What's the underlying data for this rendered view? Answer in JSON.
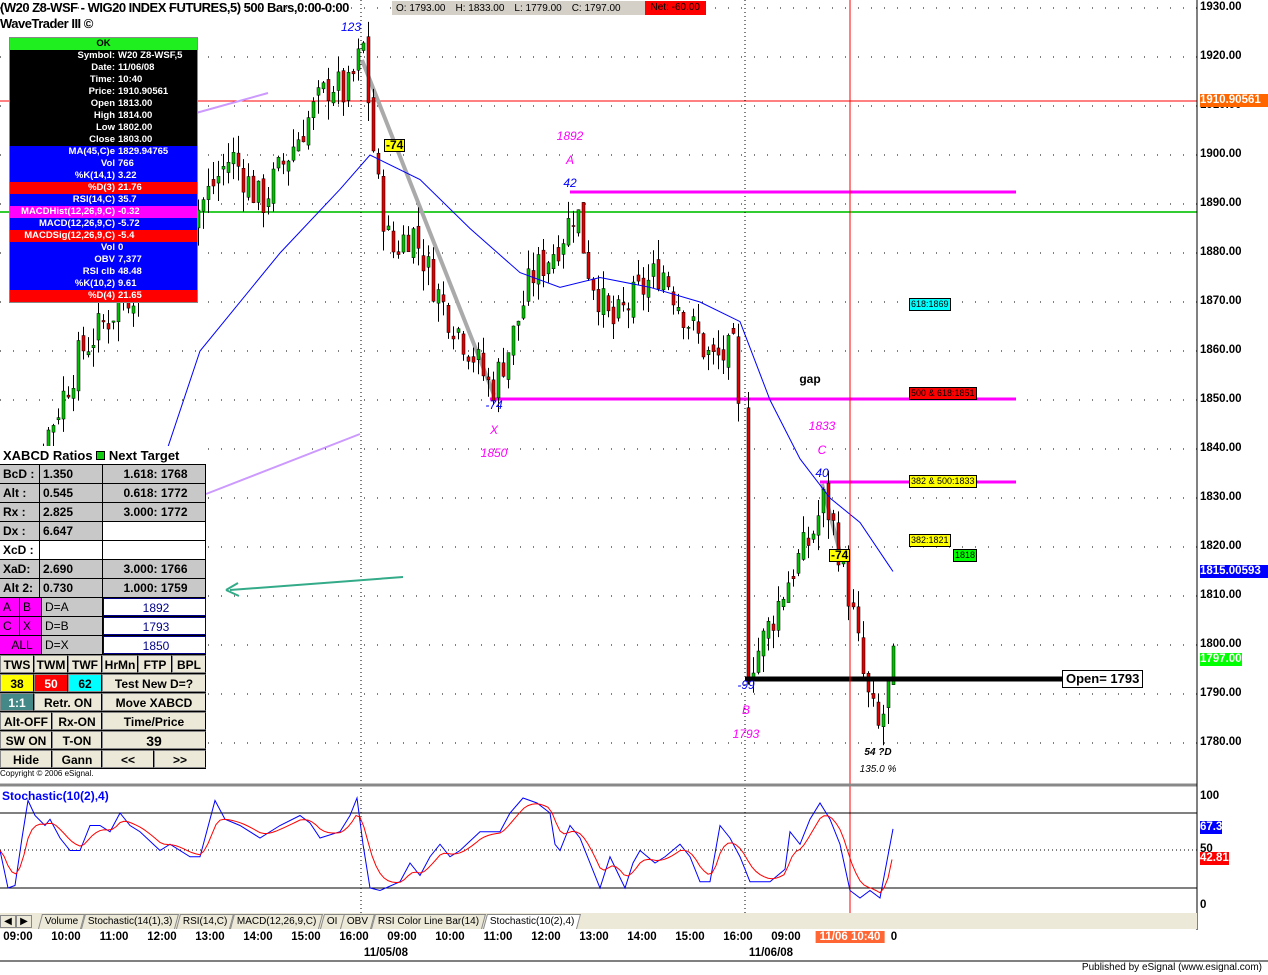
{
  "header": {
    "title": "(W20 Z8-WSF - WIG20 INDEX FUTURES,5) 500 Bars,0:00-0:00",
    "subtitle": "WaveTrader III ©",
    "ohlc": {
      "open": "O: 1793.00",
      "high": "H: 1833.00",
      "low": "L: 1779.00",
      "close": "C: 1797.00",
      "net": "Net: -60.00"
    }
  },
  "info_panel": {
    "status": "OK",
    "rows": [
      {
        "l": "Symbol:",
        "v": "W20 Z8-WSF,5",
        "c": "bk"
      },
      {
        "l": "Date:",
        "v": "11/06/08",
        "c": "bk"
      },
      {
        "l": "Time:",
        "v": "10:40",
        "c": "bk"
      },
      {
        "l": "Price:",
        "v": "1910.90561",
        "c": "bk"
      },
      {
        "l": "Open",
        "v": "1813.00",
        "c": "bk"
      },
      {
        "l": "High",
        "v": "1814.00",
        "c": "bk"
      },
      {
        "l": "Low",
        "v": "1802.00",
        "c": "bk"
      },
      {
        "l": "Close",
        "v": "1803.00",
        "c": "bk"
      },
      {
        "l": "MA(45,C)e",
        "v": "1829.94765",
        "c": "bl"
      },
      {
        "l": "Vol",
        "v": "766",
        "c": "bl"
      },
      {
        "l": "%K(14,1)",
        "v": "3.22",
        "c": "bl"
      },
      {
        "l": "%D(3)",
        "v": "21.76",
        "c": "rd"
      },
      {
        "l": "RSI(14,C)",
        "v": "35.7",
        "c": "bl"
      },
      {
        "l": "MACDHist(12,26,9,C)",
        "v": "-0.32",
        "c": "mg"
      },
      {
        "l": "MACD(12,26,9,C)",
        "v": "-5.72",
        "c": "bl"
      },
      {
        "l": "MACDSig(12,26,9,C)",
        "v": "-5.4",
        "c": "rd"
      },
      {
        "l": "Vol",
        "v": "0",
        "c": "bl"
      },
      {
        "l": "OBV",
        "v": "7,377",
        "c": "bl"
      },
      {
        "l": "RSI clb",
        "v": "48.48",
        "c": "bl"
      },
      {
        "l": "%K(10,2)",
        "v": "9.61",
        "c": "bl"
      },
      {
        "l": "%D(4)",
        "v": "21.65",
        "c": "rd"
      }
    ]
  },
  "xabcd": {
    "header": "XABCD Ratios",
    "next_target": "Next Target",
    "ratios": [
      {
        "n": "BcD :",
        "v": "1.350",
        "t": "1.618: 1768"
      },
      {
        "n": "Alt  :",
        "v": "0.545",
        "t": "0.618: 1772"
      },
      {
        "n": "Rx  :",
        "v": "2.825",
        "t": "3.000: 1772"
      },
      {
        "n": "Dx  :",
        "v": "6.647",
        "t": ""
      },
      {
        "n": "XcD :",
        "v": "",
        "t": ""
      },
      {
        "n": "XaD:",
        "v": "2.690",
        "t": "3.000: 1766"
      },
      {
        "n": "Alt 2:",
        "v": "0.730",
        "t": "1.000: 1759"
      }
    ],
    "points": [
      {
        "a": "A",
        "b": "B",
        "d": "D=A",
        "v": "1892"
      },
      {
        "a": "C",
        "b": "X",
        "d": "D=B",
        "v": "1793"
      },
      {
        "a": "ALL",
        "b": "",
        "d": "D=X",
        "v": "1850"
      }
    ],
    "buttons": {
      "tws": "TWS",
      "twm": "TWM",
      "twf": "TWF",
      "hrmn": "HrMn",
      "ftp": "FTP",
      "bpl": "BPL",
      "b38": "38",
      "b50": "50",
      "b62": "62",
      "test": "Test New D=?",
      "one": "1:1",
      "retr": "Retr. ON",
      "move": "Move XABCD",
      "alt": "Alt-OFF",
      "rx": "Rx-ON",
      "tp": "Time/Price",
      "sw": "SW ON",
      "ton": "T-ON",
      "num": "39",
      "hide": "Hide",
      "gann": "Gann",
      "prev": "<<",
      "next": ">>"
    },
    "copyright": "Copyright © 2006 eSignal."
  },
  "annotations": {
    "p123": "123",
    "m74a": "-74",
    "p1892": "1892",
    "pA": "A",
    "p42": "42",
    "m74b": "-74",
    "pX": "X",
    "p1850": "1850",
    "gap": "gap",
    "p1833": "1833",
    "pC": "C",
    "p40": "40",
    "m99": "-99",
    "pB": "B",
    "p1793": "1793",
    "d54": "54 ?D",
    "pct": "135.0 %",
    "m74c": "-74",
    "open": "Open= 1793"
  },
  "tags": {
    "t1869": "618:1869",
    "t1851": "500 & 618:1851",
    "t1833": "382 & 500:1833",
    "t1821": "382:1821",
    "t1818": "1818"
  },
  "price_axis": {
    "ticks": [
      "1930.00",
      "1920.00",
      "1910.00",
      "1900.00",
      "1890.00",
      "1880.00",
      "1870.00",
      "1860.00",
      "1850.00",
      "1840.00",
      "1830.00",
      "1820.00",
      "1810.00",
      "1800.00",
      "1790.00",
      "1780.00"
    ],
    "ma_label": "1910.90561",
    "blue_label": "1815.00593",
    "last_label": "1797.00"
  },
  "stoch_axis": {
    "ticks": [
      "100",
      "50",
      "0"
    ],
    "k_label": "67.3",
    "d_label": "42.81",
    "title": "Stochastic(10(2),4)"
  },
  "tabs": [
    "Volume",
    "Stochastic(14(1),3)",
    "RSI(14,C)",
    "MACD(12,26,9,C)",
    "OI",
    "OBV",
    "RSI Color Line Bar(14)",
    "Stochastic(10(2),4)"
  ],
  "time_axis": {
    "labels": [
      "09:00",
      "10:00",
      "11:00",
      "12:00",
      "13:00",
      "14:00",
      "15:00",
      "16:00",
      "09:00",
      "10:00",
      "11:00",
      "12:00",
      "13:00",
      "14:00",
      "15:00",
      "16:00",
      "09:00"
    ],
    "cursor": "11/06 10:40",
    "tail": "0",
    "dates": [
      "11/05/08",
      "11/06/08"
    ]
  },
  "footer": "Published by eSignal (www.esignal.com)",
  "colors": {
    "up": "#00c000",
    "down": "#e00000",
    "ma": "#0000ff",
    "magenta": "#ff00ff"
  },
  "chart_data": {
    "type": "candlestick",
    "ylim": [
      1775,
      1932
    ],
    "price_path": [
      [
        0,
        1820
      ],
      [
        40,
        1840
      ],
      [
        80,
        1860
      ],
      [
        120,
        1870
      ],
      [
        160,
        1880
      ],
      [
        200,
        1890
      ],
      [
        230,
        1900
      ],
      [
        260,
        1890
      ],
      [
        300,
        1905
      ],
      [
        330,
        1915
      ],
      [
        345,
        1912
      ],
      [
        362,
        1922
      ],
      [
        375,
        1895
      ],
      [
        390,
        1880
      ],
      [
        410,
        1885
      ],
      [
        440,
        1870
      ],
      [
        470,
        1860
      ],
      [
        490,
        1852
      ],
      [
        510,
        1862
      ],
      [
        530,
        1875
      ],
      [
        550,
        1880
      ],
      [
        565,
        1885
      ],
      [
        575,
        1890
      ],
      [
        585,
        1878
      ],
      [
        610,
        1865
      ],
      [
        630,
        1870
      ],
      [
        660,
        1877
      ],
      [
        690,
        1865
      ],
      [
        710,
        1858
      ],
      [
        735,
        1860
      ],
      [
        745,
        1795
      ],
      [
        760,
        1800
      ],
      [
        790,
        1815
      ],
      [
        810,
        1822
      ],
      [
        823,
        1830
      ],
      [
        835,
        1822
      ],
      [
        850,
        1808
      ],
      [
        865,
        1790
      ],
      [
        878,
        1782
      ],
      [
        893,
        1797
      ]
    ],
    "ma_path": [
      [
        110,
        1805
      ],
      [
        200,
        1860
      ],
      [
        280,
        1880
      ],
      [
        340,
        1893
      ],
      [
        370,
        1900
      ],
      [
        420,
        1895
      ],
      [
        470,
        1885
      ],
      [
        520,
        1876
      ],
      [
        560,
        1873
      ],
      [
        600,
        1875
      ],
      [
        650,
        1873
      ],
      [
        700,
        1870
      ],
      [
        740,
        1866
      ],
      [
        770,
        1850
      ],
      [
        800,
        1838
      ],
      [
        830,
        1830
      ],
      [
        860,
        1825
      ],
      [
        893,
        1815
      ]
    ],
    "stoch_k": [
      [
        0,
        50
      ],
      [
        8,
        20
      ],
      [
        15,
        22
      ],
      [
        22,
        60
      ],
      [
        28,
        90
      ],
      [
        35,
        78
      ],
      [
        45,
        70
      ],
      [
        50,
        75
      ],
      [
        60,
        60
      ],
      [
        70,
        50
      ],
      [
        80,
        50
      ],
      [
        90,
        70
      ],
      [
        100,
        70
      ],
      [
        110,
        65
      ],
      [
        120,
        80
      ],
      [
        130,
        70
      ],
      [
        140,
        65
      ],
      [
        160,
        50
      ],
      [
        170,
        55
      ],
      [
        190,
        45
      ],
      [
        200,
        45
      ],
      [
        215,
        90
      ],
      [
        225,
        75
      ],
      [
        240,
        70
      ],
      [
        260,
        60
      ],
      [
        280,
        70
      ],
      [
        300,
        78
      ],
      [
        310,
        72
      ],
      [
        320,
        60
      ],
      [
        340,
        65
      ],
      [
        350,
        78
      ],
      [
        357,
        92
      ],
      [
        363,
        55
      ],
      [
        370,
        20
      ],
      [
        380,
        18
      ],
      [
        400,
        25
      ],
      [
        410,
        40
      ],
      [
        420,
        30
      ],
      [
        430,
        45
      ],
      [
        440,
        55
      ],
      [
        450,
        45
      ],
      [
        460,
        50
      ],
      [
        480,
        65
      ],
      [
        500,
        65
      ],
      [
        510,
        80
      ],
      [
        523,
        92
      ],
      [
        537,
        88
      ],
      [
        550,
        80
      ],
      [
        555,
        55
      ],
      [
        560,
        50
      ],
      [
        570,
        70
      ],
      [
        580,
        60
      ],
      [
        600,
        20
      ],
      [
        610,
        45
      ],
      [
        625,
        20
      ],
      [
        633,
        40
      ],
      [
        640,
        50
      ],
      [
        655,
        40
      ],
      [
        665,
        45
      ],
      [
        680,
        55
      ],
      [
        690,
        45
      ],
      [
        700,
        25
      ],
      [
        710,
        25
      ],
      [
        720,
        70
      ],
      [
        730,
        60
      ],
      [
        740,
        45
      ],
      [
        750,
        25
      ],
      [
        760,
        25
      ],
      [
        770,
        25
      ],
      [
        785,
        35
      ],
      [
        790,
        65
      ],
      [
        800,
        55
      ],
      [
        810,
        75
      ],
      [
        820,
        88
      ],
      [
        830,
        75
      ],
      [
        840,
        55
      ],
      [
        850,
        18
      ],
      [
        860,
        12
      ],
      [
        870,
        18
      ],
      [
        880,
        12
      ],
      [
        893,
        67.3
      ]
    ],
    "stoch_levels": [
      80,
      50,
      20
    ]
  }
}
